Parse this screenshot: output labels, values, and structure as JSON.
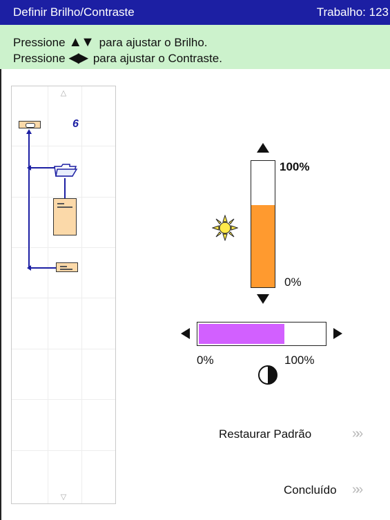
{
  "header": {
    "title": "Definir Brilho/Contraste",
    "job": "Trabalho: 123"
  },
  "instructions": {
    "line1_prefix": "Pressione",
    "line1_suffix": "para ajustar o Brilho.",
    "line2_prefix": "Pressione",
    "line2_suffix": "para ajustar o Contraste."
  },
  "preview": {
    "page_number": "6"
  },
  "brightness": {
    "max_label": "100%",
    "min_label": "0%",
    "level_percent": 65
  },
  "contrast": {
    "min_label": "0%",
    "max_label": "100%",
    "level_percent": 69
  },
  "actions": {
    "restore_label": "Restaurar Padrão",
    "done_label": "Concluído"
  },
  "colors": {
    "title_bg": "#1c1fa3",
    "instr_bg": "#ccf2cc",
    "brightness_fill": "#ff9a2f",
    "contrast_fill": "#d260ff"
  }
}
